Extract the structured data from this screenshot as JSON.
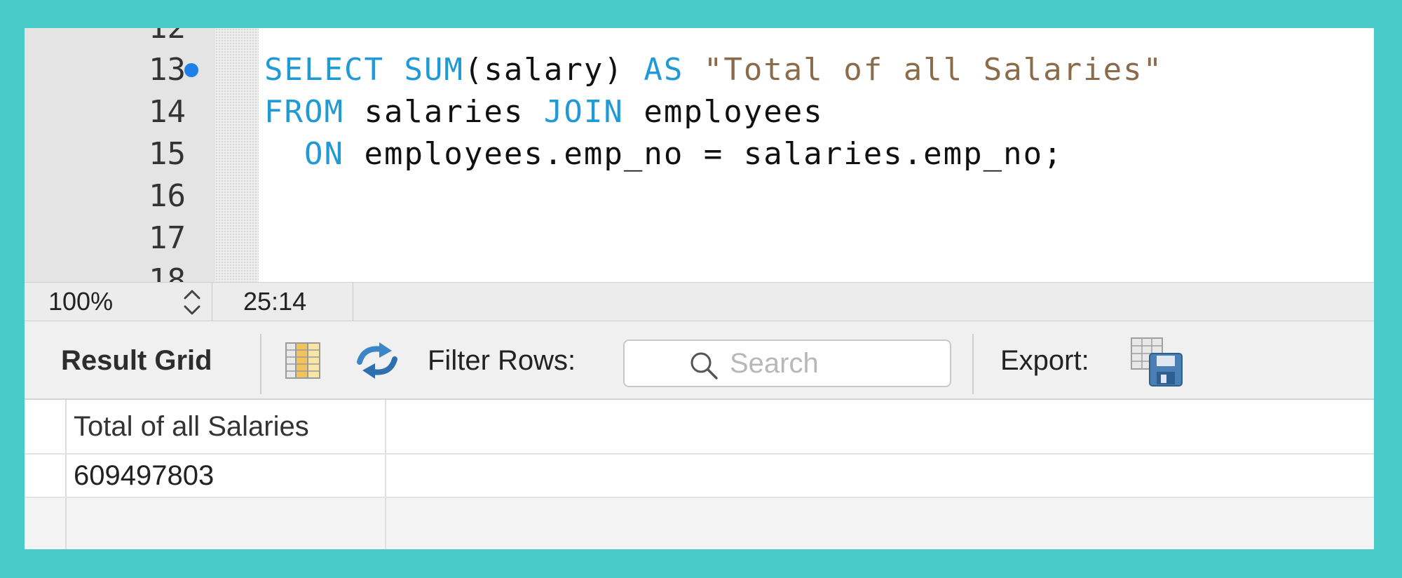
{
  "editor": {
    "lines": [
      {
        "num": "12",
        "segments": []
      },
      {
        "num": "13",
        "marker": true,
        "segments": [
          {
            "t": "SELECT",
            "c": "kw"
          },
          {
            "t": " ",
            "c": ""
          },
          {
            "t": "SUM",
            "c": "kw"
          },
          {
            "t": "(salary) ",
            "c": ""
          },
          {
            "t": "AS",
            "c": "kw"
          },
          {
            "t": " ",
            "c": ""
          },
          {
            "t": "\"Total of all Salaries\"",
            "c": "str"
          }
        ]
      },
      {
        "num": "14",
        "segments": [
          {
            "t": "FROM",
            "c": "kw"
          },
          {
            "t": " salaries ",
            "c": ""
          },
          {
            "t": "JOIN",
            "c": "kw"
          },
          {
            "t": " employees",
            "c": ""
          }
        ]
      },
      {
        "num": "15",
        "segments": [
          {
            "t": "  ",
            "c": ""
          },
          {
            "t": "ON",
            "c": "kw"
          },
          {
            "t": " employees.emp_no = salaries.emp_no;",
            "c": ""
          }
        ]
      },
      {
        "num": "16",
        "segments": []
      },
      {
        "num": "17",
        "segments": []
      },
      {
        "num": "18",
        "segments": []
      }
    ]
  },
  "status_bar": {
    "zoom": "100%",
    "cursor_position": "25:14"
  },
  "toolbar": {
    "result_grid_label": "Result Grid",
    "filter_rows_label": "Filter Rows:",
    "search_placeholder": "Search",
    "search_value": "",
    "export_label": "Export:",
    "icons": {
      "grid": "result-grid-toggle-icon",
      "refresh": "refresh-icon",
      "search": "search-icon",
      "export": "export-save-icon"
    }
  },
  "result_grid": {
    "columns": [
      "Total of all Salaries"
    ],
    "rows": [
      [
        "609497803"
      ]
    ]
  },
  "colors": {
    "background": "#48CBC9",
    "keyword": "#1f9ad6",
    "string": "#8b6b4a",
    "breakpoint_marker": "#1f7fe8"
  }
}
